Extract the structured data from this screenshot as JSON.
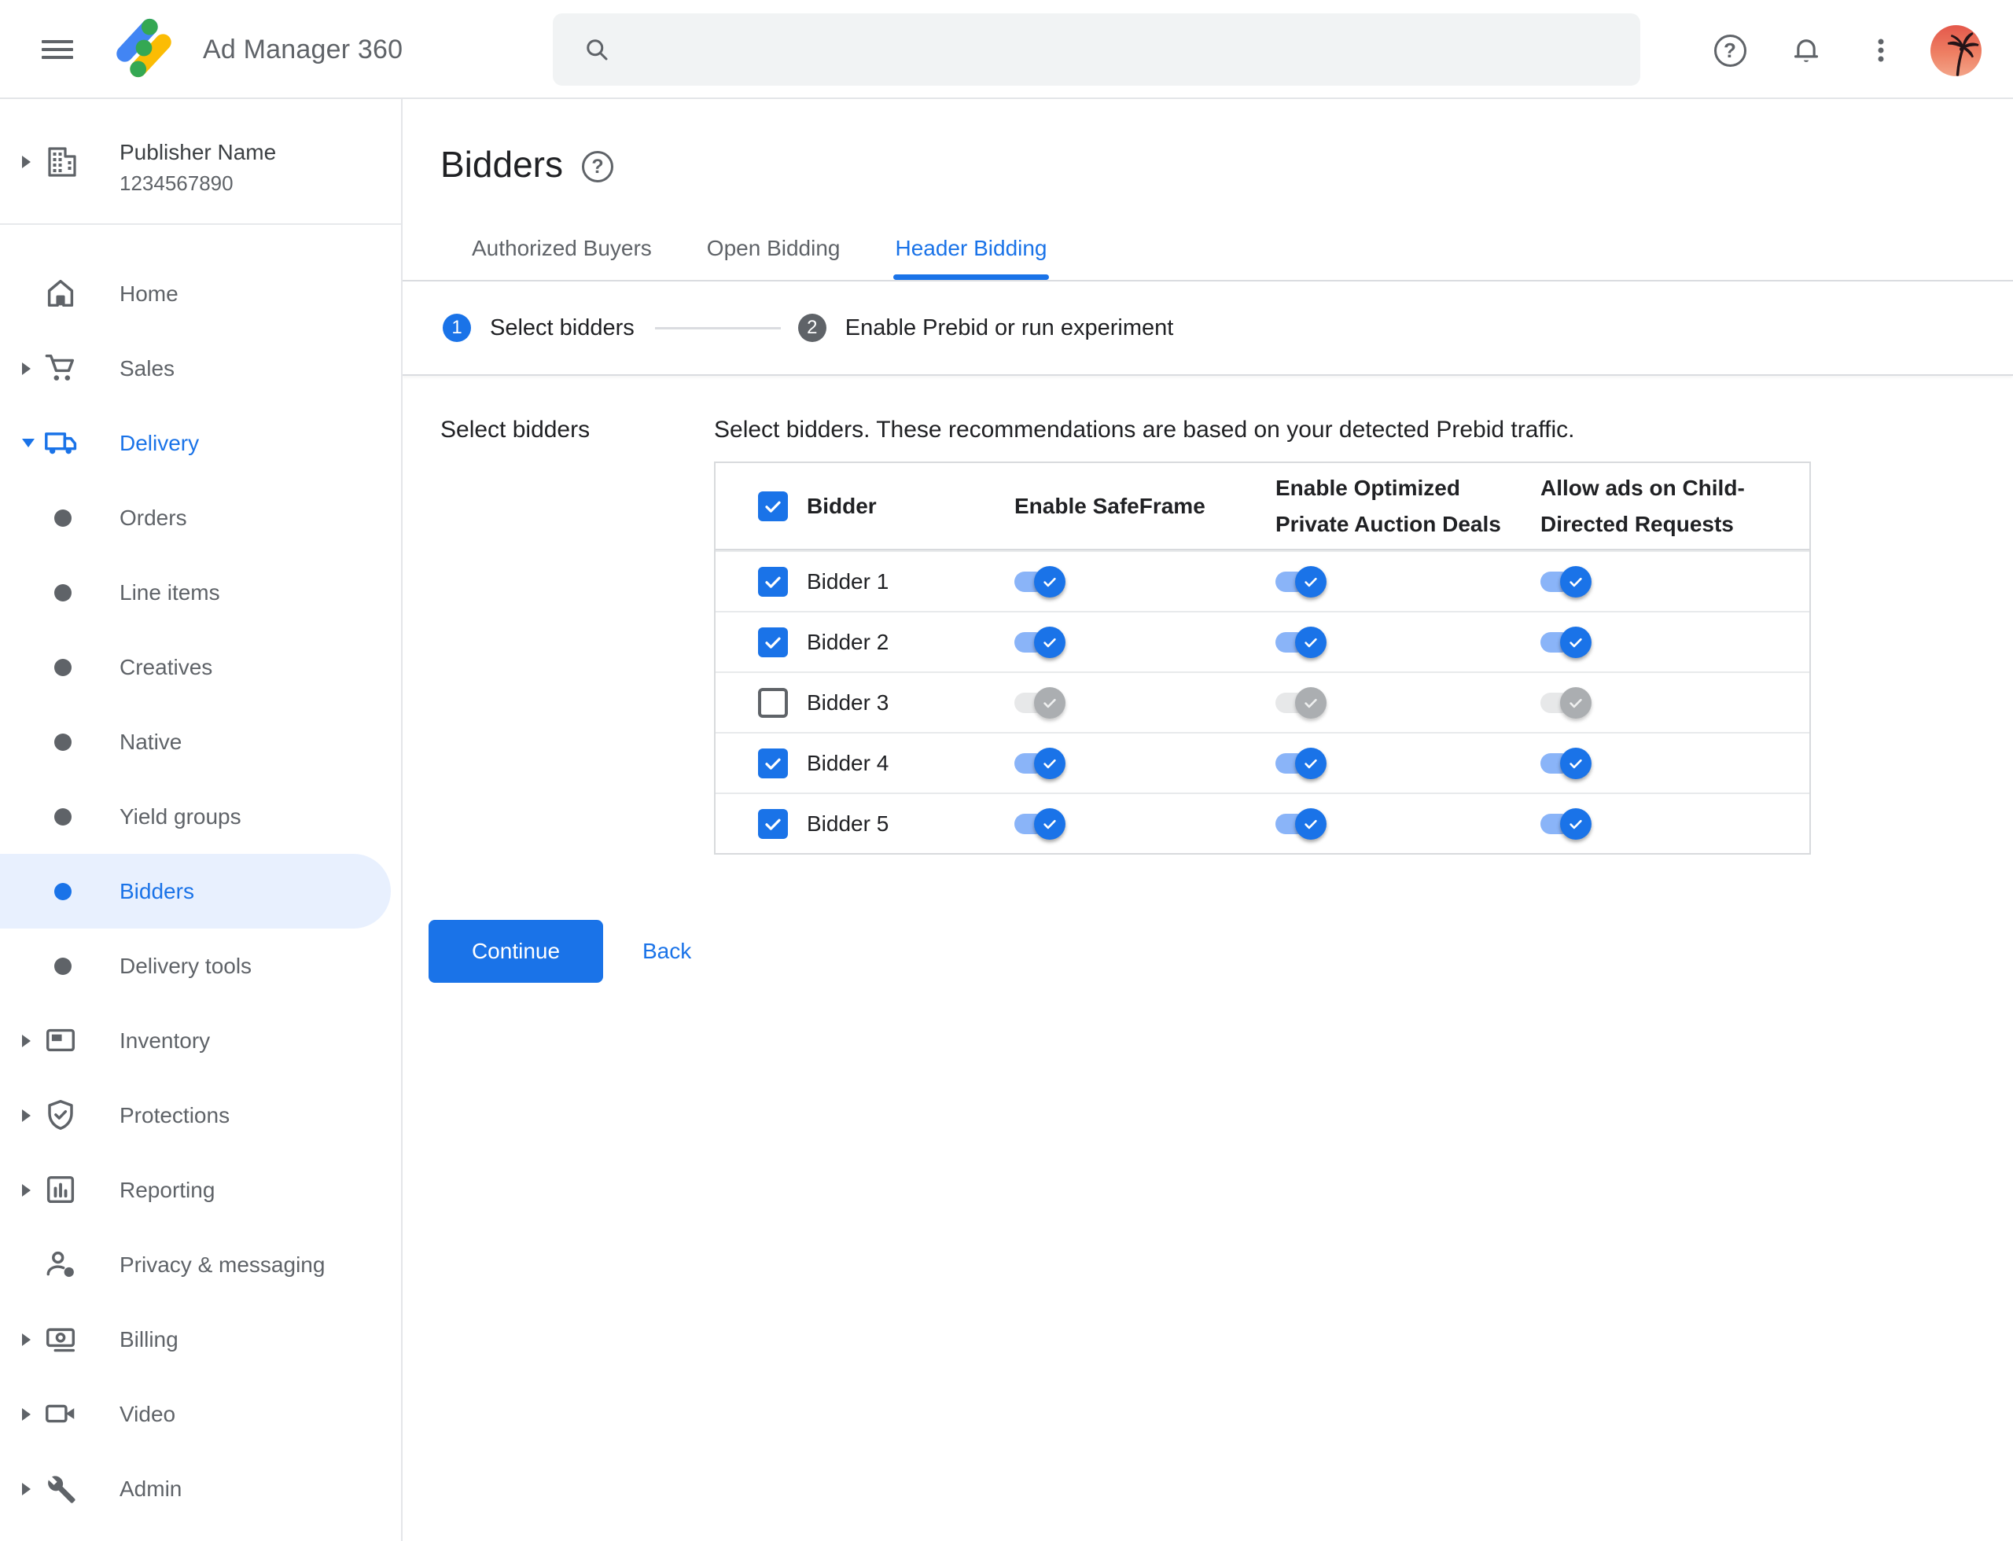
{
  "app": {
    "title": "Ad Manager 360"
  },
  "topbar": {
    "search": {
      "value": "",
      "placeholder": ""
    },
    "icons": [
      "help-icon",
      "notifications-icon",
      "more-vert-icon"
    ],
    "avatar": "palm-tree-sunset"
  },
  "publisher": {
    "name": "Publisher Name",
    "id": "1234567890",
    "icon": "building-icon"
  },
  "sidebar": {
    "items": [
      {
        "id": "home",
        "label": "Home",
        "icon": "home",
        "chevron": null,
        "sub": false
      },
      {
        "id": "sales",
        "label": "Sales",
        "icon": "cart",
        "chevron": "right",
        "sub": false
      },
      {
        "id": "delivery",
        "label": "Delivery",
        "icon": "truck",
        "chevron": "down",
        "sub": false,
        "expanded": true
      },
      {
        "id": "orders",
        "label": "Orders",
        "icon": "bullet",
        "chevron": null,
        "sub": true
      },
      {
        "id": "line-items",
        "label": "Line items",
        "icon": "bullet",
        "chevron": null,
        "sub": true
      },
      {
        "id": "creatives",
        "label": "Creatives",
        "icon": "bullet",
        "chevron": null,
        "sub": true
      },
      {
        "id": "native",
        "label": "Native",
        "icon": "bullet",
        "chevron": null,
        "sub": true
      },
      {
        "id": "yield-groups",
        "label": "Yield groups",
        "icon": "bullet",
        "chevron": null,
        "sub": true
      },
      {
        "id": "bidders",
        "label": "Bidders",
        "icon": "bullet",
        "chevron": null,
        "sub": true,
        "selected": true
      },
      {
        "id": "delivery-tools",
        "label": "Delivery tools",
        "icon": "bullet",
        "chevron": null,
        "sub": true
      },
      {
        "id": "inventory",
        "label": "Inventory",
        "icon": "ad-unit",
        "chevron": "right",
        "sub": false
      },
      {
        "id": "protections",
        "label": "Protections",
        "icon": "shield-check",
        "chevron": "right",
        "sub": false
      },
      {
        "id": "reporting",
        "label": "Reporting",
        "icon": "bar-chart",
        "chevron": "right",
        "sub": false
      },
      {
        "id": "privacy",
        "label": "Privacy & messaging",
        "icon": "person-badge",
        "chevron": null,
        "sub": false
      },
      {
        "id": "billing",
        "label": "Billing",
        "icon": "payments",
        "chevron": "right",
        "sub": false
      },
      {
        "id": "video",
        "label": "Video",
        "icon": "videocam",
        "chevron": "right",
        "sub": false
      },
      {
        "id": "admin",
        "label": "Admin",
        "icon": "wrench",
        "chevron": "right",
        "sub": false
      }
    ]
  },
  "page": {
    "title": "Bidders",
    "help_icon": "help-icon",
    "tabs": [
      {
        "label": "Authorized Buyers",
        "active": false
      },
      {
        "label": "Open Bidding",
        "active": false
      },
      {
        "label": "Header Bidding",
        "active": true
      }
    ],
    "stepper": [
      {
        "number": "1",
        "label": "Select bidders",
        "state": "active"
      },
      {
        "number": "2",
        "label": "Enable Prebid or run experiment",
        "state": "upcoming"
      }
    ],
    "form_label": "Select bidders",
    "description": "Select bidders. These recommendations are based on your detected Prebid traffic."
  },
  "table": {
    "select_all_checked": true,
    "columns": [
      "Bidder",
      "Enable SafeFrame",
      "Enable Optimized Private Auction Deals",
      "Allow ads on Child-Directed Requests"
    ],
    "rows": [
      {
        "name": "Bidder 1",
        "checked": true,
        "toggles": [
          true,
          true,
          true
        ]
      },
      {
        "name": "Bidder 2",
        "checked": true,
        "toggles": [
          true,
          true,
          true
        ]
      },
      {
        "name": "Bidder 3",
        "checked": false,
        "toggles": [
          false,
          false,
          false
        ]
      },
      {
        "name": "Bidder 4",
        "checked": true,
        "toggles": [
          true,
          true,
          true
        ]
      },
      {
        "name": "Bidder 5",
        "checked": true,
        "toggles": [
          true,
          true,
          true
        ]
      }
    ]
  },
  "actions": {
    "continue": "Continue",
    "back": "Back"
  },
  "colors": {
    "accent": "#1a73e8",
    "toggle_track_on": "#8ab4f8",
    "selected_pill": "#e8f0fe",
    "text_gray": "#5f6368",
    "divider": "#dadce0",
    "search_bg": "#f1f3f4",
    "disabled_thumb": "#abaeb1",
    "disabled_track": "#e7e8e9"
  }
}
